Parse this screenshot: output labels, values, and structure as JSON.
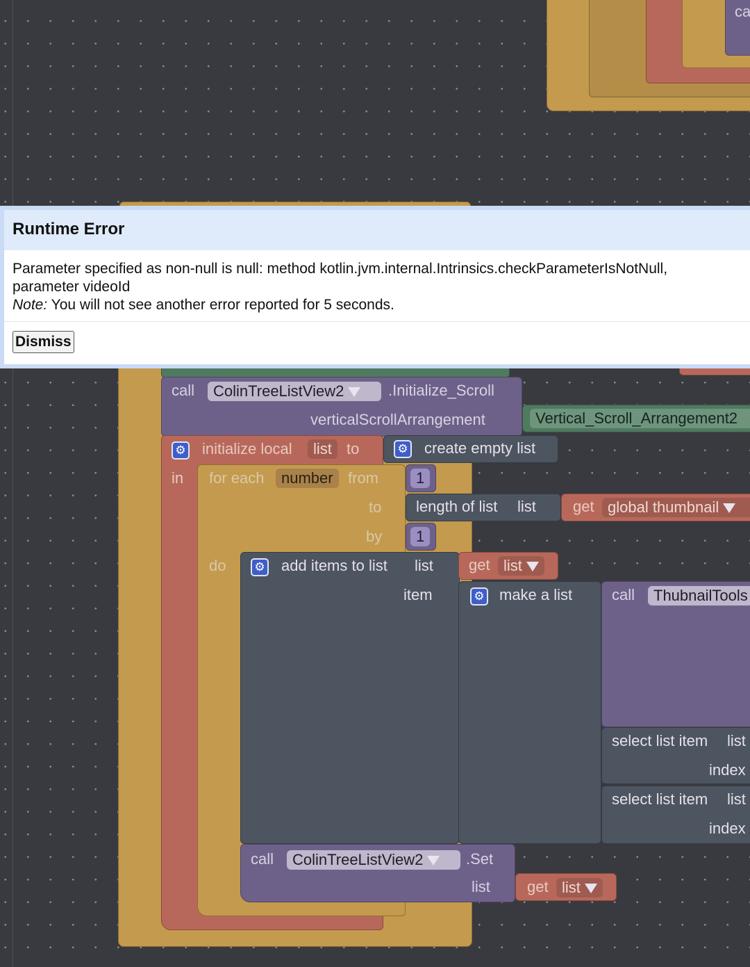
{
  "dialog": {
    "title": "Runtime Error",
    "message": "Parameter specified as non-null is null: method kotlin.jvm.internal.Intrinsics.checkParameterIsNotNull, parameter videoId",
    "note_label": "Note:",
    "note_text": " You will not see another error reported for 5 seconds.",
    "dismiss_label": "Dismiss"
  },
  "blocks": {
    "top_fragment": "ca",
    "call1": {
      "call_label": "call",
      "component": "ColinTreeListView2",
      "method": ".Initialize_Scroll",
      "param_label": "verticalScrollArrangement",
      "param_value": "Vertical_Scroll_Arrangement2"
    },
    "init_local": {
      "label": "initialize local",
      "var": "list",
      "to_label": "to",
      "in_label": "in",
      "value": "create empty list"
    },
    "for_each": {
      "label": "for each",
      "var": "number",
      "from_label": "from",
      "from_value": "1",
      "to_label": "to",
      "by_label": "by",
      "by_value": "1",
      "do_label": "do",
      "length_label": "length of list",
      "list_label": "list",
      "get_label": "get",
      "global_var": "global thumbnail"
    },
    "add_items": {
      "label": "add items to list",
      "list_label": "list",
      "get_label": "get",
      "get_var": "list",
      "item_label": "item",
      "make_list": "make a list",
      "call_label": "call",
      "component": "ThubnailTools",
      "select1": "select list item",
      "select1_list": "list",
      "index1": "index",
      "select2": "select list item",
      "select2_list": "list",
      "index2": "index"
    },
    "call2": {
      "call_label": "call",
      "component": "ColinTreeListView2",
      "method": ".Set",
      "param_label": "list",
      "get_label": "get",
      "get_var": "list"
    }
  }
}
